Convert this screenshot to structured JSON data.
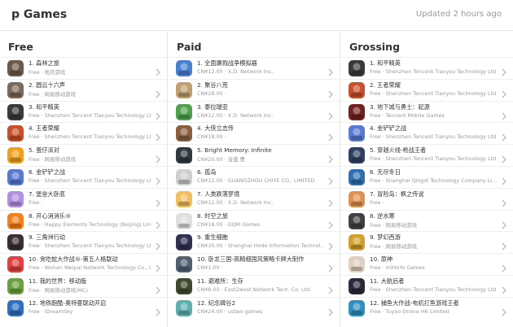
{
  "header": {
    "title": "p Games",
    "updated": "Updated 2 hours ago"
  },
  "columns": [
    {
      "title": "Free",
      "items": [
        {
          "name": "1. 森林之旅",
          "price": "Free",
          "publisher": "地月游戏",
          "color": "#6b5a4a"
        },
        {
          "name": "2. 圆云十六声",
          "price": "Free",
          "publisher": "网易移动游戏",
          "color": "#7a6a5a"
        },
        {
          "name": "3. 和平精英",
          "price": "Free",
          "publisher": "Shenzhen Tencent Tianyou Technology Ltd",
          "color": "#3a3a3a"
        },
        {
          "name": "4. 王者荣耀",
          "price": "Free",
          "publisher": "Shenzhen Tencent Tianyou Technology Ltd",
          "color": "#c8502a"
        },
        {
          "name": "5. 蛋仔派对",
          "price": "Free",
          "publisher": "网易移动游戏",
          "color": "#f0a020"
        },
        {
          "name": "6. 金铲铲之战",
          "price": "Free",
          "publisher": "Shenzhen Tencent Tianyou Technology Ltd",
          "color": "#5a7ad0"
        },
        {
          "name": "7. 堡垒大卧底",
          "price": "Free",
          "publisher": "",
          "color": "#b090e0"
        },
        {
          "name": "8. 开心消消乐®",
          "price": "Free",
          "publisher": "Happy Elements Technology (Beijing) Limi...",
          "color": "#f08020"
        },
        {
          "name": "9. 三角洲行动",
          "price": "Free",
          "publisher": "Shenzhen Tencent Tianyou Technology Ltd",
          "color": "#3a3030"
        },
        {
          "name": "10. 贪吃蛇大作战®-第五人格联动",
          "price": "Free",
          "publisher": "Wuhan Weipai Network Technology Co., Lt...",
          "color": "#e04040"
        },
        {
          "name": "11. 我的世界：移动版",
          "price": "Free",
          "publisher": "网易移动游戏(MC)",
          "color": "#6aa040"
        },
        {
          "name": "12. 地铁跑酷-奥特曼联动开启",
          "price": "Free",
          "publisher": "iDreamSky",
          "color": "#3070c0"
        }
      ]
    },
    {
      "title": "Paid",
      "items": [
        {
          "name": "1. 全面屠戮战争模拟器",
          "price": "CN¥12.00",
          "publisher": "X.D. Network Inc.",
          "color": "#4a80d0"
        },
        {
          "name": "2. 聚谷八荒",
          "price": "CN¥28.00",
          "publisher": "",
          "color": "#c0a070"
        },
        {
          "name": "3. 泰拉瑞亚",
          "price": "CN¥12.00",
          "publisher": "X.D. Network Inc.",
          "color": "#50a050"
        },
        {
          "name": "4. 大侠立志传",
          "price": "CN¥18.00",
          "publisher": "",
          "color": "#8a6040"
        },
        {
          "name": "5. Bright Memory: Infinite",
          "price": "CN¥20.00",
          "publisher": "音盛 曹",
          "color": "#303840"
        },
        {
          "name": "6. 孤岛",
          "price": "CN¥12.00",
          "publisher": "GUANGZHOU CHIYE CO., LIMITED",
          "color": "#d0d0d0"
        },
        {
          "name": "7. 人类跌落梦境",
          "price": "CN¥12.00",
          "publisher": "X.D. Network Inc.",
          "color": "#f0c060"
        },
        {
          "name": "8. 时空之旅",
          "price": "CN¥18.00",
          "publisher": "DQM Games",
          "color": "#e0e0e0"
        },
        {
          "name": "9. 重生细胞",
          "price": "CN¥30.00",
          "publisher": "Shanghai Hode Information Technol...",
          "color": "#303050"
        },
        {
          "name": "10. 卧龙三国-高精细国风策略卡牌大制作",
          "price": "CN¥1.00",
          "publisher": "",
          "color": "#506070"
        },
        {
          "name": "11. 避难所：生存",
          "price": "CN¥8.00",
          "publisher": "East2west Network Tech. Co. Ltd.",
          "color": "#404a30"
        },
        {
          "name": "12. 纪念碑谷2",
          "price": "CN¥24.00",
          "publisher": "ustwo games",
          "color": "#60b0b0"
        }
      ]
    },
    {
      "title": "Grossing",
      "items": [
        {
          "name": "1. 和平精英",
          "price": "Free",
          "publisher": "Shenzhen Tencent Tianyou Technology Ltd",
          "color": "#3a3a3a"
        },
        {
          "name": "2. 王者荣耀",
          "price": "Free",
          "publisher": "Shenzhen Tencent Tianyou Technology Ltd",
          "color": "#c8502a"
        },
        {
          "name": "3. 地下城与勇士：起源",
          "price": "Free",
          "publisher": "Tencent Mobile Games",
          "color": "#702020"
        },
        {
          "name": "4. 金铲铲之战",
          "price": "Free",
          "publisher": "Shenzhen Tencent Tianyou Technology Ltd",
          "color": "#5a7ad0"
        },
        {
          "name": "5. 穿越火线-枪战王者",
          "price": "Free",
          "publisher": "Shenzhen Tencent Tianyou Technology Ltd",
          "color": "#304060"
        },
        {
          "name": "6. 无尽冬日",
          "price": "Free",
          "publisher": "Shanghai Qingdi Technology Company Li...",
          "color": "#3070b0"
        },
        {
          "name": "7. 冒险岛：枫之传说",
          "price": "Free",
          "publisher": "",
          "color": "#e09050"
        },
        {
          "name": "8. 逆水寒",
          "price": "Free",
          "publisher": "网易移动游戏",
          "color": "#404040"
        },
        {
          "name": "9. 梦幻西游",
          "price": "Free",
          "publisher": "网易移动游戏",
          "color": "#d0a030"
        },
        {
          "name": "10. 原神",
          "price": "Free",
          "publisher": "miHoYo Games",
          "color": "#e0d0c0"
        },
        {
          "name": "11. 大航后者",
          "price": "Free",
          "publisher": "Shenzhen Tencent Tianyou Technology Ltd",
          "color": "#2a2a3a"
        },
        {
          "name": "12. 捕鱼大作战-电机打鱼游戏王者",
          "price": "Free",
          "publisher": "Tuyoo Online HK Limited",
          "color": "#3090c0"
        }
      ]
    }
  ]
}
